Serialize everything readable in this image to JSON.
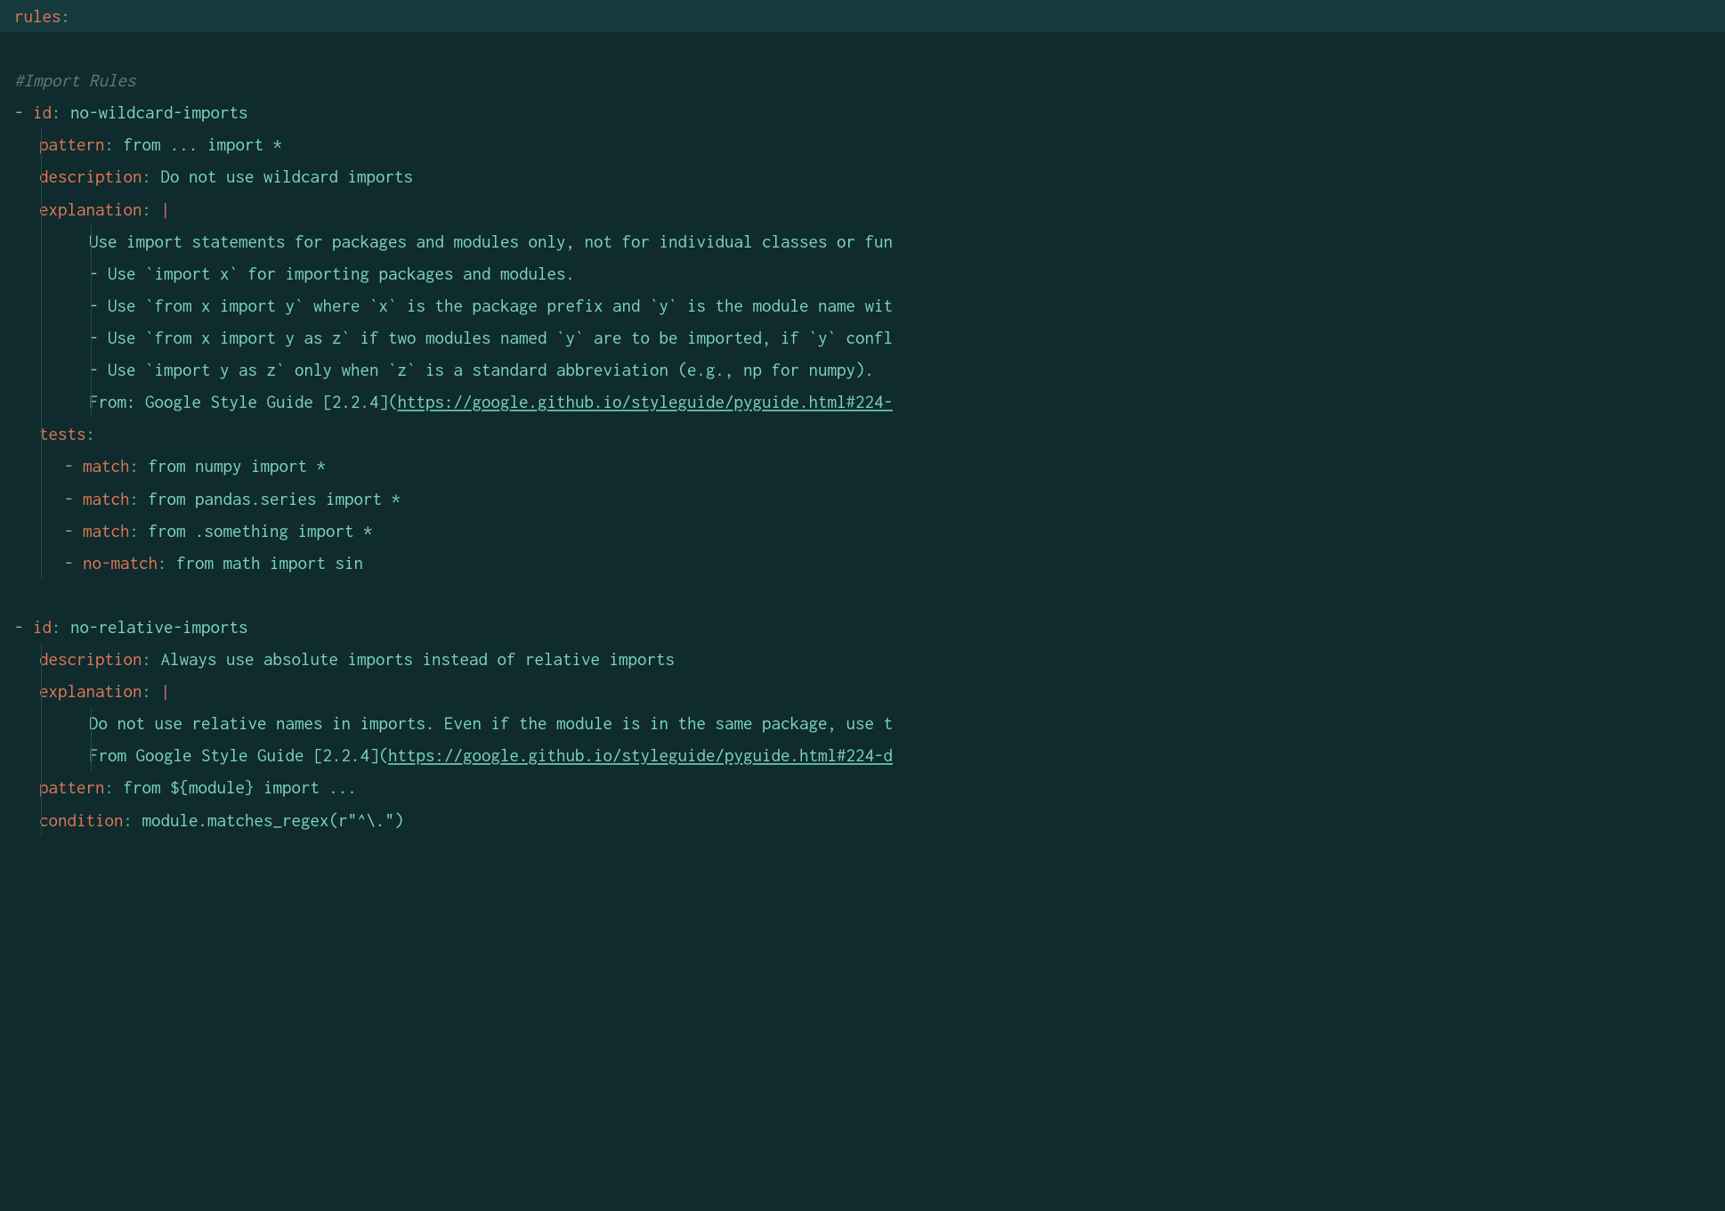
{
  "topKey": "rules",
  "colon": ":",
  "blank": " ",
  "section1": {
    "comment": "#Import Rules",
    "dash": "-",
    "idKey": "id",
    "idVal": "no-wildcard-imports",
    "patternKey": "pattern",
    "patternVal": "from ... import *",
    "descKey": "description",
    "descVal": "Do not use wildcard imports",
    "explKey": "explanation",
    "pipe": "|",
    "expl": {
      "l1": "Use import statements for packages and modules only, not for individual classes or fun",
      "l2": "- Use `import x` for importing packages and modules.",
      "l3": "- Use `from x import y` where `x` is the package prefix and `y` is the module name wit",
      "l4": "- Use `from x import y as z` if two modules named `y` are to be imported, if `y` confl",
      "l5": "- Use `import y as z` only when `z` is a standard abbreviation (e.g., np for numpy).",
      "l6a": "From: Google Style Guide [2.2.4](",
      "l6link": "https://google.github.io/styleguide/pyguide.html#224-"
    },
    "testsKey": "tests",
    "tests": {
      "m1k": "match",
      "m1v": "from numpy import *",
      "m2k": "match",
      "m2v": "from pandas.series import *",
      "m3k": "match",
      "m3v": "from .something import *",
      "m4k": "no-match",
      "m4v": "from math import sin"
    }
  },
  "section2": {
    "dash": "-",
    "idKey": "id",
    "idVal": "no-relative-imports",
    "descKey": "description",
    "descVal": "Always use absolute imports instead of relative imports",
    "explKey": "explanation",
    "pipe": "|",
    "expl": {
      "l1": "Do not use relative names in imports. Even if the module is in the same package, use t",
      "l2a": "From Google Style Guide [2.2.4](",
      "l2link": "https://google.github.io/styleguide/pyguide.html#224-d"
    },
    "patternKey": "pattern",
    "patternVal": "from ${module} import ...",
    "conditionKey": "condition",
    "conditionVal": "module.matches_regex(r\"^\\.\")"
  }
}
